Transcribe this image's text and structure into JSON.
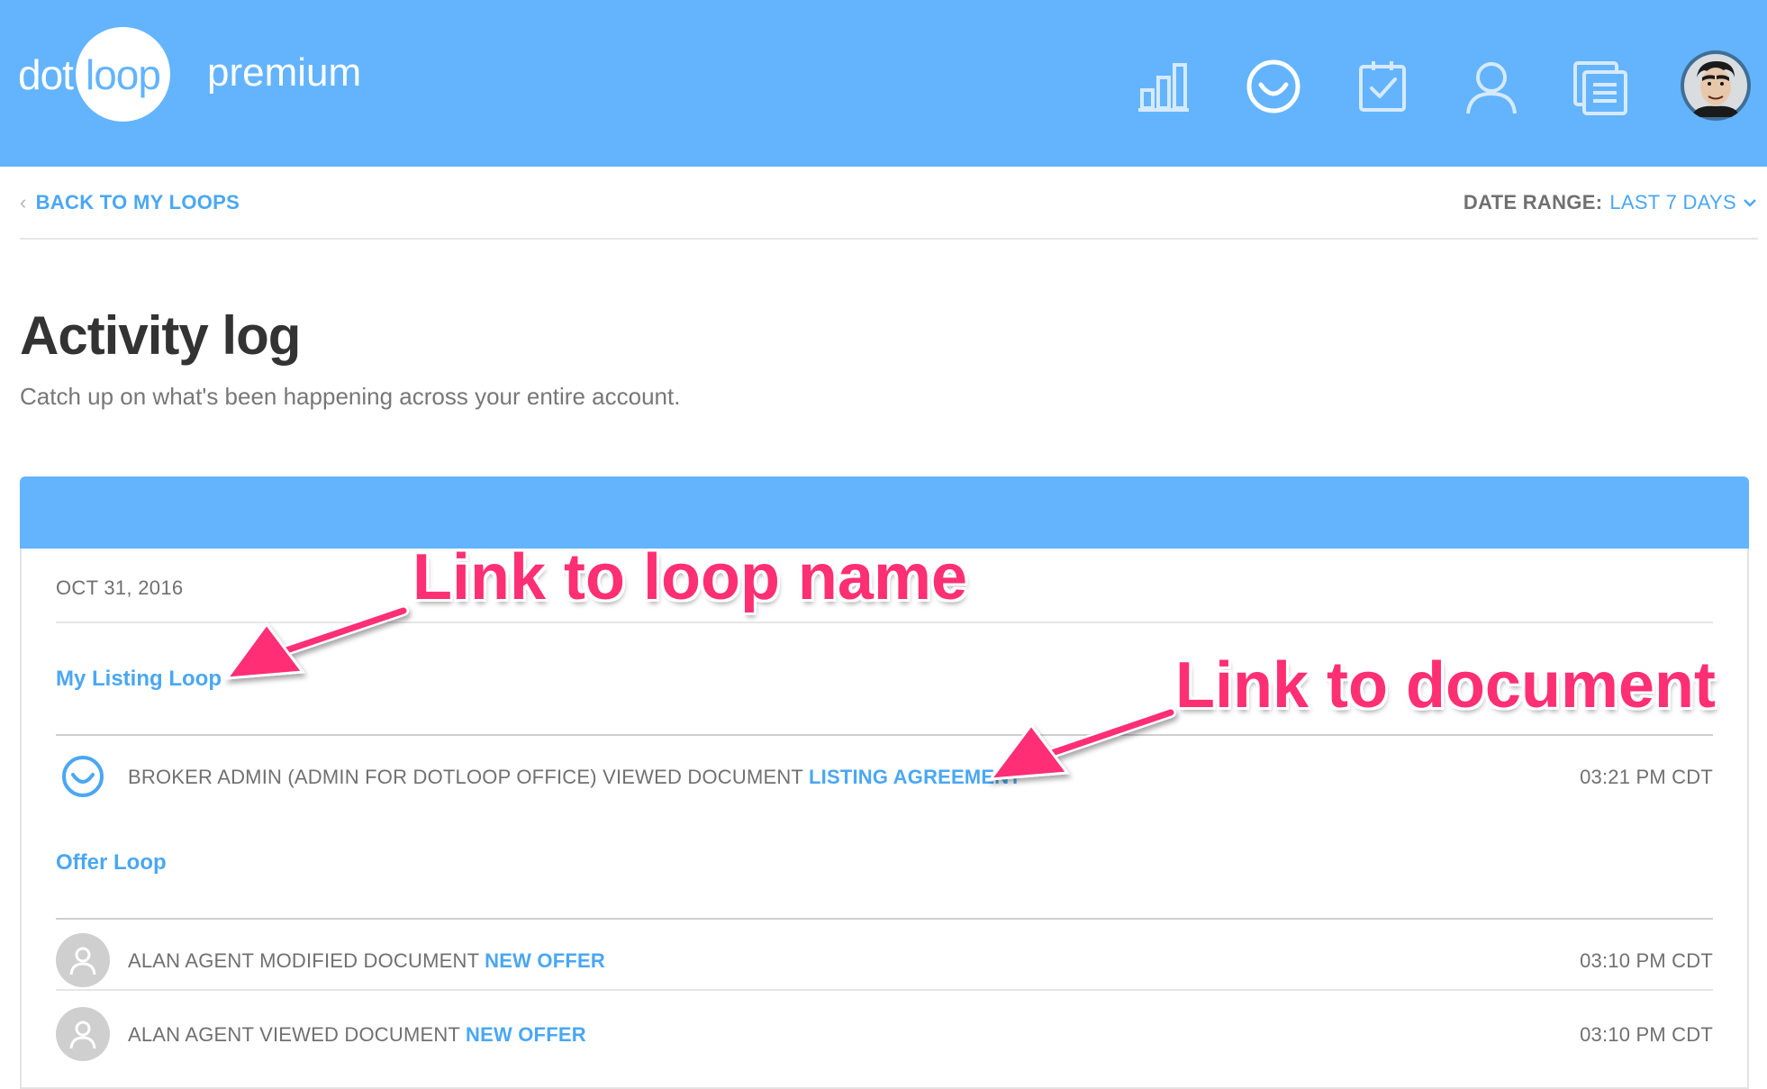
{
  "header": {
    "logo_dot": "dot",
    "logo_loop": "loop",
    "logo_premium": "premium",
    "nav_icons": [
      "chart-icon",
      "smile-activity-icon",
      "tasks-checklist-icon",
      "user-profile-icon",
      "documents-icon",
      "user-avatar"
    ]
  },
  "subnav": {
    "back_chevron": "‹",
    "back_label": "BACK TO MY LOOPS",
    "date_range_label": "DATE RANGE:",
    "date_range_value": "LAST 7 DAYS"
  },
  "page": {
    "title": "Activity log",
    "subtitle": "Catch up on what's been happening across your entire account."
  },
  "activity": {
    "date": "OCT 31, 2016",
    "loops": [
      {
        "name": "My Listing Loop",
        "entries": [
          {
            "icon": "dotloop-smile-icon",
            "text": "BROKER ADMIN (ADMIN FOR DOTLOOP OFFICE) VIEWED DOCUMENT ",
            "doc": "LISTING AGREEMENT",
            "time": "03:21 PM CDT"
          }
        ]
      },
      {
        "name": "Offer Loop",
        "entries": [
          {
            "icon": "user-avatar-icon",
            "text": "ALAN AGENT MODIFIED DOCUMENT ",
            "doc": "NEW OFFER",
            "time": "03:10 PM CDT"
          },
          {
            "icon": "user-avatar-icon",
            "text": "ALAN AGENT VIEWED DOCUMENT ",
            "doc": "NEW OFFER",
            "time": "03:10 PM CDT"
          }
        ]
      }
    ]
  },
  "annotations": {
    "loop_name": "Link to loop name",
    "document": "Link to document"
  },
  "colors": {
    "brand_blue": "#63b4fd",
    "link_blue": "#4aa7f4",
    "annotation_pink": "#ff2f74"
  }
}
